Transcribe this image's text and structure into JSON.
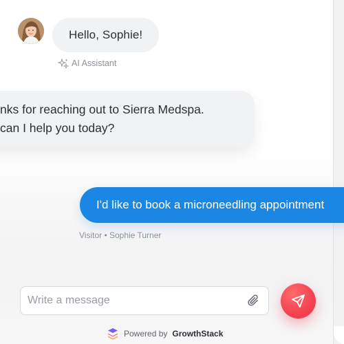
{
  "greeting": {
    "avatar_icon": "user-avatar-photo",
    "text": "Hello, Sophie!",
    "sender_label": "AI Assistant",
    "sender_icon": "sparkles-icon"
  },
  "bot_message": {
    "line1": "nks for reaching out to Sierra Medspa.",
    "line2": "can I help you today?"
  },
  "user_message": {
    "text": "I'd like to book a microneedling appointment",
    "meta": "Visitor • Sophie Turner"
  },
  "composer": {
    "placeholder": "Write a message",
    "value": "",
    "attach_icon": "paperclip-icon",
    "send_icon": "send-icon"
  },
  "footer": {
    "powered_prefix": "Powered by",
    "brand": "GrowthStack",
    "logo_icon": "growthstack-logo-icon"
  },
  "colors": {
    "user_bubble": "#1987e3",
    "send_button": "#f44352",
    "bubble_grey": "#f1f2f4",
    "meta_text": "#8d9099"
  }
}
